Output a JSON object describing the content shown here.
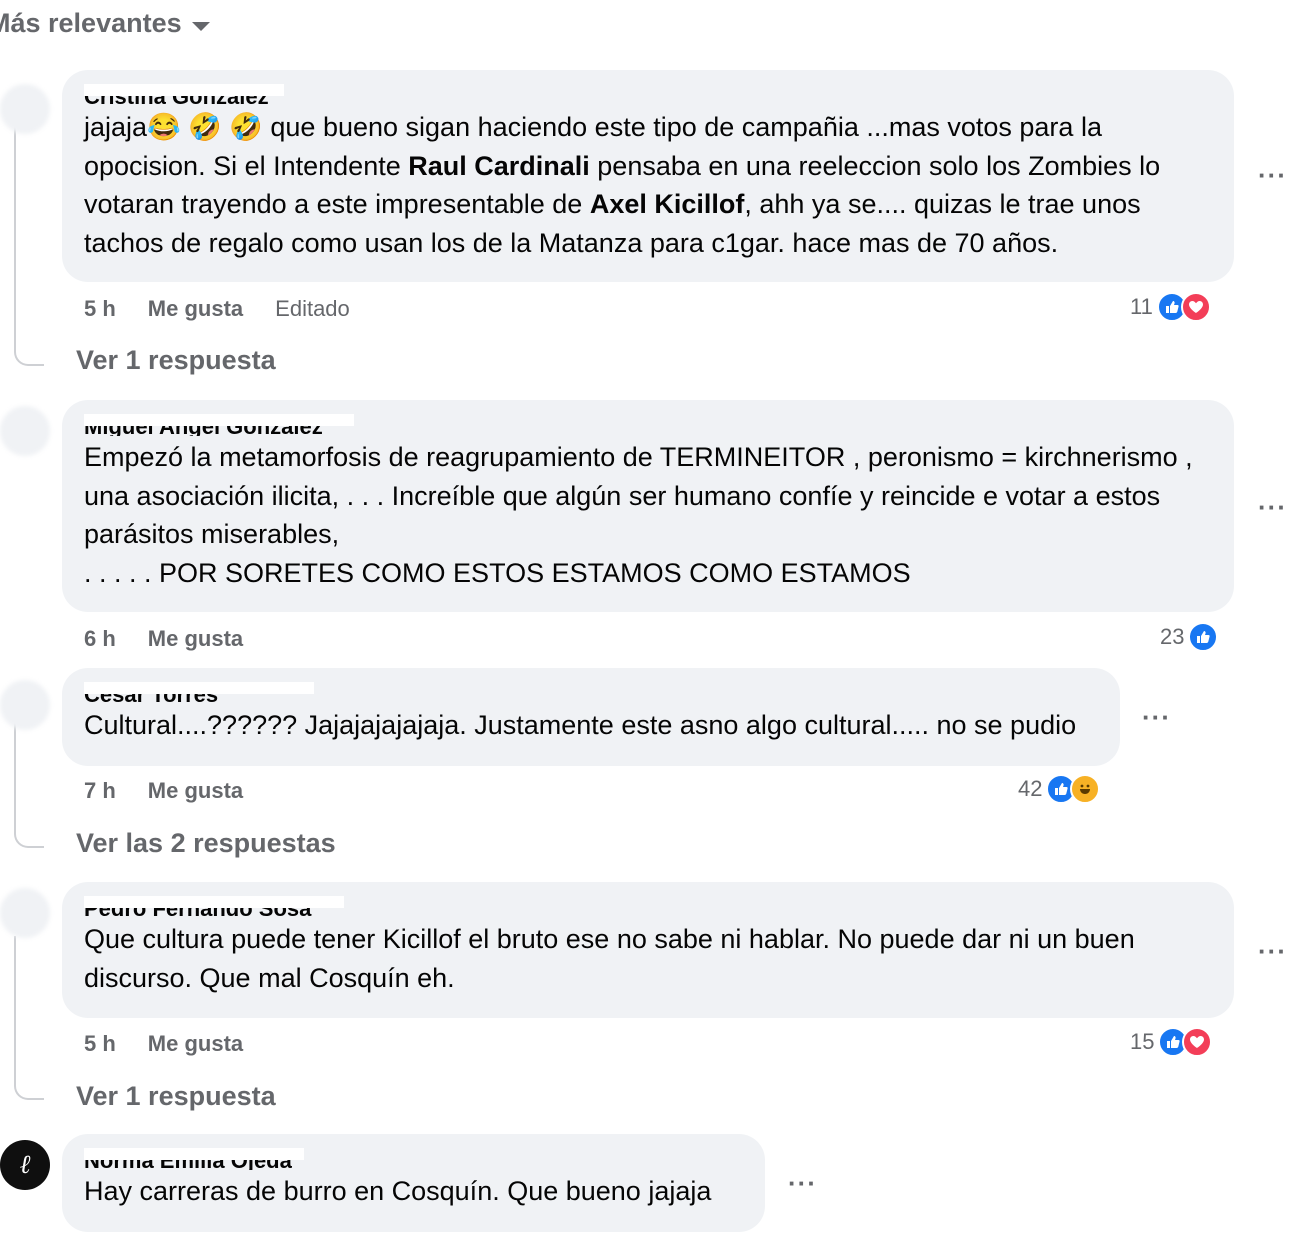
{
  "sort_label": "Más relevantes",
  "comments": [
    {
      "author": "Cristina Gonzalez",
      "text_html": "jajaja😂 🤣 🤣 que bueno sigan haciendo este tipo de campañia ...mas votos para la opocision. Si el Intendente <b>Raul Cardinali</b> pensaba en una reeleccion solo los Zombies lo votaran trayendo a este impresentable de <b>Axel Kicillof</b>, ahh ya se.... quizas le trae unos tachos de regalo como usan los de la Matanza para c1gar. hace mas de 70 años.",
      "time": "5 h",
      "like": "Me gusta",
      "edited": "Editado",
      "count": "11",
      "reactions": [
        "like",
        "love"
      ],
      "replies": "Ver 1 respuesta"
    },
    {
      "author": "Miguel Angel Gonzalez",
      "text_html": "Empezó la metamorfosis de reagrupamiento de TERMINEITOR , peronismo = kirchnerismo , una asociación ilicita, . . . Increíble que algún ser humano confíe y reincide e votar a estos parásitos miserables,<br>. . . . . POR SORETES COMO ESTOS ESTAMOS COMO ESTAMOS",
      "time": "6 h",
      "like": "Me gusta",
      "count": "23",
      "reactions": [
        "like"
      ]
    },
    {
      "author": "César Torres",
      "text_html": "Cultural....?????? Jajajajajajaja. Justamente este asno algo cultural..... no se pudio",
      "time": "7 h",
      "like": "Me gusta",
      "count": "42",
      "reactions": [
        "like",
        "haha"
      ],
      "replies": "Ver las 2 respuestas"
    },
    {
      "author": "Pedro Fernando Sosa",
      "text_html": "Que cultura puede tener Kicillof el bruto ese no sabe ni hablar. No puede dar ni un buen discurso. Que mal Cosquín eh.",
      "time": "5 h",
      "like": "Me gusta",
      "count": "15",
      "reactions": [
        "like",
        "love"
      ],
      "replies": "Ver 1 respuesta"
    },
    {
      "author": "Norma Emilia Ojeda",
      "text_html": "Hay carreras de burro en Cosquín. Que bueno jajaja"
    }
  ],
  "icons": {
    "more": "more-options-icon",
    "like": "like-reaction-icon",
    "love": "love-reaction-icon",
    "haha": "haha-reaction-icon",
    "caret": "caret-down-icon"
  },
  "colors": {
    "bubble": "#f0f2f5",
    "meta": "#65676b",
    "like": "#1877f2",
    "love": "#f33e58",
    "haha": "#f7b125"
  }
}
